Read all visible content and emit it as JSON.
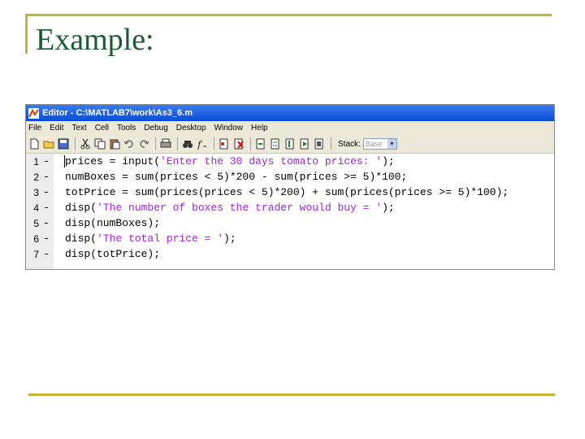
{
  "slide": {
    "title": "Example:"
  },
  "window": {
    "title": "Editor - C:\\MATLAB7\\work\\As3_6.m",
    "menu": [
      "File",
      "Edit",
      "Text",
      "Cell",
      "Tools",
      "Debug",
      "Desktop",
      "Window",
      "Help"
    ],
    "stack_label": "Stack:",
    "stack_value": "Base"
  },
  "code_lines": [
    {
      "num": "1",
      "marker": "-",
      "pre": "prices = input(",
      "str": "'Enter the 30 days tomato prices: '",
      "post": ");"
    },
    {
      "num": "2",
      "marker": "-",
      "pre": "numBoxes = sum(prices < 5)*200 - sum(prices >= 5)*100;",
      "str": "",
      "post": ""
    },
    {
      "num": "3",
      "marker": "-",
      "pre": "totPrice = sum(prices(prices < 5)*200) + sum(prices(prices >= 5)*100);",
      "str": "",
      "post": ""
    },
    {
      "num": "4",
      "marker": "-",
      "pre": "disp(",
      "str": "'The number of boxes the trader would buy = '",
      "post": ");"
    },
    {
      "num": "5",
      "marker": "-",
      "pre": "disp(numBoxes);",
      "str": "",
      "post": ""
    },
    {
      "num": "6",
      "marker": "-",
      "pre": "disp(",
      "str": "'The total price = '",
      "post": ");"
    },
    {
      "num": "7",
      "marker": "-",
      "pre": "disp(totPrice);",
      "str": "",
      "post": ""
    }
  ],
  "colors": {
    "title": "#1c5a33",
    "accent": "#c9b23a",
    "string": "#a020f0"
  }
}
